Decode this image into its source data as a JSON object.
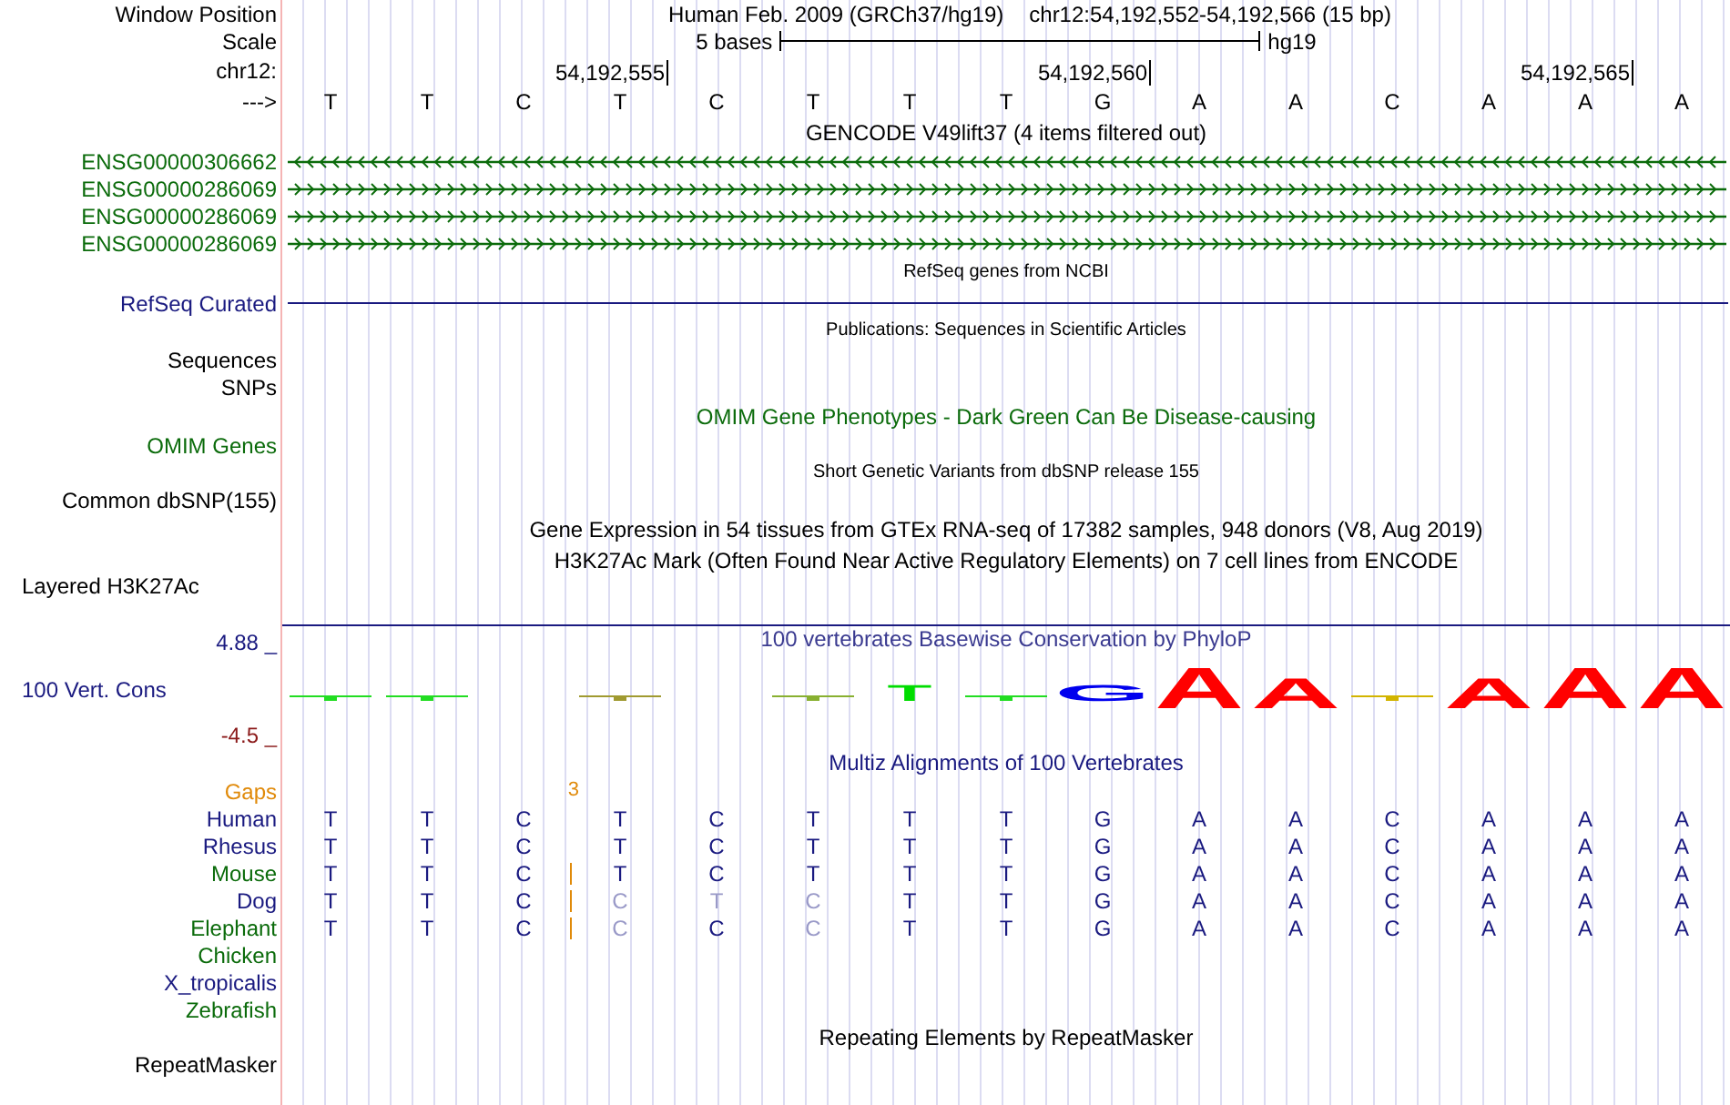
{
  "header": {
    "window_position_label": "Window Position",
    "assembly_title": "Human Feb. 2009 (GRCh37/hg19)",
    "position": "chr12:54,192,552-54,192,566 (15 bp)",
    "scale_label": "Scale",
    "scale_text": "5 bases",
    "scale_assembly": "hg19",
    "chrom_label": "chr12:",
    "strand_label": "--->",
    "bases": [
      {
        "base": "T"
      },
      {
        "base": "T"
      },
      {
        "base": "C"
      },
      {
        "base": "T",
        "tick": "54,192,555"
      },
      {
        "base": "C"
      },
      {
        "base": "T"
      },
      {
        "base": "T"
      },
      {
        "base": "T"
      },
      {
        "base": "G",
        "tick": "54,192,560"
      },
      {
        "base": "A"
      },
      {
        "base": "A"
      },
      {
        "base": "C"
      },
      {
        "base": "A"
      },
      {
        "base": "A",
        "tick": "54,192,565"
      },
      {
        "base": "A"
      }
    ]
  },
  "gencode": {
    "title": "GENCODE V49lift37 (4 items filtered out)",
    "genes": [
      {
        "name": "ENSG00000306662",
        "reverse": true
      },
      {
        "name": "ENSG00000286069",
        "reverse": false
      },
      {
        "name": "ENSG00000286069",
        "reverse": false
      },
      {
        "name": "ENSG00000286069",
        "reverse": false
      }
    ]
  },
  "refseq": {
    "title": "RefSeq genes from NCBI",
    "label": "RefSeq Curated"
  },
  "publications": {
    "title": "Publications: Sequences in Scientific Articles",
    "labels": [
      "Sequences",
      "SNPs"
    ]
  },
  "omim": {
    "title": "OMIM Gene Phenotypes - Dark Green Can Be Disease-causing",
    "label": "OMIM Genes"
  },
  "dbsnp": {
    "title": "Short Genetic Variants from dbSNP release 155",
    "label": "Common dbSNP(155)"
  },
  "gtex": {
    "title": "Gene Expression in 54 tissues from GTEx RNA-seq of 17382 samples, 948 donors (V8, Aug 2019)"
  },
  "h3k27ac": {
    "title": "H3K27Ac Mark (Often Found Near Active Regulatory Elements) on 7 cell lines from ENCODE",
    "label": "Layered H3K27Ac"
  },
  "phylop": {
    "title": "100 vertebrates Basewise Conservation by PhyloP",
    "label": "100 Vert. Cons",
    "ymax": "4.88 _",
    "ymin": "-4.5 _",
    "logo": [
      {
        "kind": "flat",
        "color": "#22dd22"
      },
      {
        "kind": "flat",
        "color": "#22dd22"
      },
      {
        "kind": "empty"
      },
      {
        "kind": "flat",
        "color": "#a09a30"
      },
      {
        "kind": "empty"
      },
      {
        "kind": "flat",
        "color": "#88b030"
      },
      {
        "kind": "short",
        "letter": "T"
      },
      {
        "kind": "flat",
        "color": "#22dd22"
      },
      {
        "kind": "short",
        "letter": "G"
      },
      {
        "kind": "tall",
        "letter": "A"
      },
      {
        "kind": "medium",
        "letter": "A"
      },
      {
        "kind": "flat",
        "color": "#d2b400"
      },
      {
        "kind": "medium",
        "letter": "A"
      },
      {
        "kind": "tall",
        "letter": "A"
      },
      {
        "kind": "tall",
        "letter": "A"
      }
    ]
  },
  "multiz": {
    "title": "Multiz Alignments of 100 Vertebrates",
    "gaps_label": "Gaps",
    "gap_count": "3",
    "species": [
      {
        "name": "Human",
        "color": "#1a1a80",
        "insertion": false,
        "bases": [
          {
            "base": "T",
            "faded": false
          },
          {
            "base": "T",
            "faded": false
          },
          {
            "base": "C",
            "faded": false
          },
          {
            "base": "T",
            "faded": false
          },
          {
            "base": "C",
            "faded": false
          },
          {
            "base": "T",
            "faded": false
          },
          {
            "base": "T",
            "faded": false
          },
          {
            "base": "T",
            "faded": false
          },
          {
            "base": "G",
            "faded": false
          },
          {
            "base": "A",
            "faded": false
          },
          {
            "base": "A",
            "faded": false
          },
          {
            "base": "C",
            "faded": false
          },
          {
            "base": "A",
            "faded": false
          },
          {
            "base": "A",
            "faded": false
          },
          {
            "base": "A",
            "faded": false
          }
        ]
      },
      {
        "name": "Rhesus",
        "color": "#1a1a80",
        "insertion": false,
        "bases": [
          {
            "base": "T",
            "faded": false
          },
          {
            "base": "T",
            "faded": false
          },
          {
            "base": "C",
            "faded": false
          },
          {
            "base": "T",
            "faded": false
          },
          {
            "base": "C",
            "faded": false
          },
          {
            "base": "T",
            "faded": false
          },
          {
            "base": "T",
            "faded": false
          },
          {
            "base": "T",
            "faded": false
          },
          {
            "base": "G",
            "faded": false
          },
          {
            "base": "A",
            "faded": false
          },
          {
            "base": "A",
            "faded": false
          },
          {
            "base": "C",
            "faded": false
          },
          {
            "base": "A",
            "faded": false
          },
          {
            "base": "A",
            "faded": false
          },
          {
            "base": "A",
            "faded": false
          }
        ]
      },
      {
        "name": "Mouse",
        "color": "#0b6b0b",
        "insertion": true,
        "bases": [
          {
            "base": "T",
            "faded": false
          },
          {
            "base": "T",
            "faded": false
          },
          {
            "base": "C",
            "faded": false
          },
          {
            "base": "T",
            "faded": false
          },
          {
            "base": "C",
            "faded": false
          },
          {
            "base": "T",
            "faded": false
          },
          {
            "base": "T",
            "faded": false
          },
          {
            "base": "T",
            "faded": false
          },
          {
            "base": "G",
            "faded": false
          },
          {
            "base": "A",
            "faded": false
          },
          {
            "base": "A",
            "faded": false
          },
          {
            "base": "C",
            "faded": false
          },
          {
            "base": "A",
            "faded": false
          },
          {
            "base": "A",
            "faded": false
          },
          {
            "base": "A",
            "faded": false
          }
        ]
      },
      {
        "name": "Dog",
        "color": "#1a1a80",
        "insertion": true,
        "bases": [
          {
            "base": "T",
            "faded": false
          },
          {
            "base": "T",
            "faded": false
          },
          {
            "base": "C",
            "faded": false
          },
          {
            "base": "C",
            "faded": true
          },
          {
            "base": "T",
            "faded": true
          },
          {
            "base": "C",
            "faded": true
          },
          {
            "base": "T",
            "faded": false
          },
          {
            "base": "T",
            "faded": false
          },
          {
            "base": "G",
            "faded": false
          },
          {
            "base": "A",
            "faded": false
          },
          {
            "base": "A",
            "faded": false
          },
          {
            "base": "C",
            "faded": false
          },
          {
            "base": "A",
            "faded": false
          },
          {
            "base": "A",
            "faded": false
          },
          {
            "base": "A",
            "faded": false
          }
        ]
      },
      {
        "name": "Elephant",
        "color": "#0b6b0b",
        "insertion": true,
        "bases": [
          {
            "base": "T",
            "faded": false
          },
          {
            "base": "T",
            "faded": false
          },
          {
            "base": "C",
            "faded": false
          },
          {
            "base": "C",
            "faded": true
          },
          {
            "base": "C",
            "faded": false
          },
          {
            "base": "C",
            "faded": true
          },
          {
            "base": "T",
            "faded": false
          },
          {
            "base": "T",
            "faded": false
          },
          {
            "base": "G",
            "faded": false
          },
          {
            "base": "A",
            "faded": false
          },
          {
            "base": "A",
            "faded": false
          },
          {
            "base": "C",
            "faded": false
          },
          {
            "base": "A",
            "faded": false
          },
          {
            "base": "A",
            "faded": false
          },
          {
            "base": "A",
            "faded": false
          }
        ]
      },
      {
        "name": "Chicken",
        "color": "#0b6b0b"
      },
      {
        "name": "X_tropicalis",
        "color": "#1a1a80"
      },
      {
        "name": "Zebrafish",
        "color": "#0b6b0b"
      }
    ]
  },
  "repeatmasker": {
    "title": "Repeating Elements by RepeatMasker",
    "label": "RepeatMasker"
  }
}
